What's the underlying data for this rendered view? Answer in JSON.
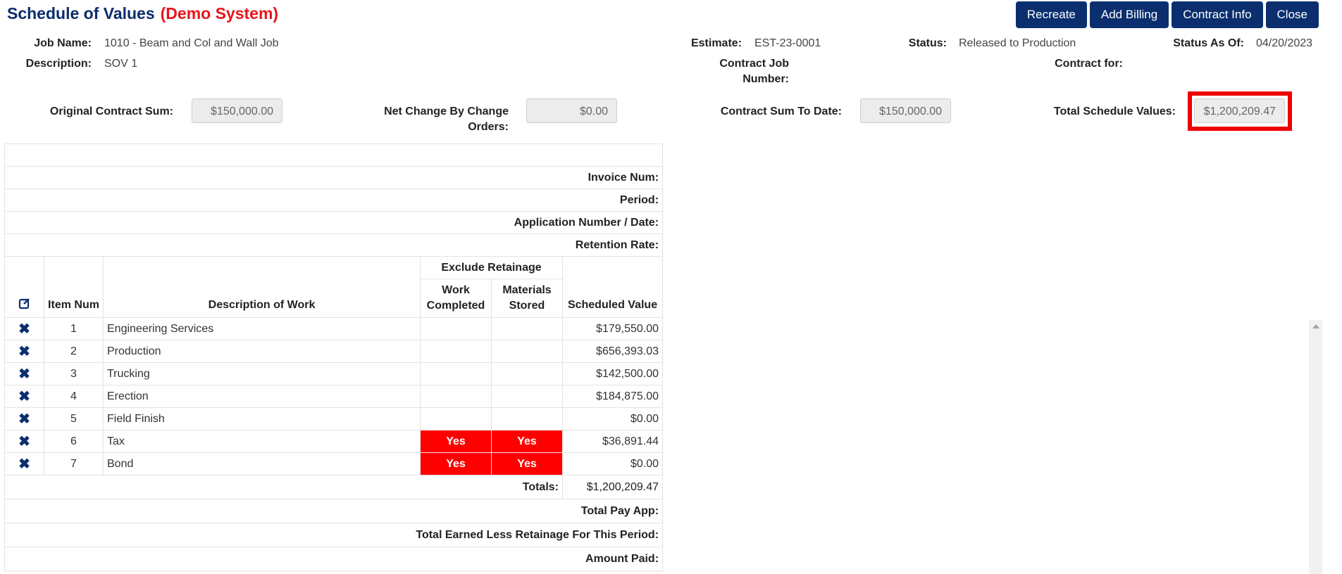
{
  "header": {
    "title": "Schedule of Values",
    "demo_label": "(Demo System)",
    "buttons": {
      "recreate": "Recreate",
      "add_billing": "Add Billing",
      "contract_info": "Contract Info",
      "close": "Close"
    }
  },
  "job": {
    "job_name_label": "Job Name:",
    "job_name": "1010 - Beam and Col and Wall Job",
    "description_label": "Description:",
    "description": "SOV 1",
    "estimate_label": "Estimate:",
    "estimate": "EST-23-0001",
    "contract_job_number_label_1": "Contract Job",
    "contract_job_number_label_2": "Number:",
    "status_label": "Status:",
    "status": "Released to Production",
    "status_as_of_label": "Status As Of:",
    "status_as_of": "04/20/2023",
    "contract_for_label": "Contract for:"
  },
  "sums": {
    "original_contract_label": "Original Contract Sum:",
    "original_contract": "$150,000.00",
    "net_change_label_1": "Net Change By Change",
    "net_change_label_2": "Orders:",
    "net_change": "$0.00",
    "contract_to_date_label": "Contract Sum To Date:",
    "contract_to_date": "$150,000.00",
    "total_schedule_label": "Total Schedule Values:",
    "total_schedule": "$1,200,209.47"
  },
  "meta_rows": {
    "invoice_num": "Invoice Num:",
    "period": "Period:",
    "application": "Application Number / Date:",
    "retention": "Retention Rate:"
  },
  "table": {
    "exclude_retainage": "Exclude Retainage",
    "col_item_num": "Item Num",
    "col_description": "Description of Work",
    "col_work_completed_1": "Work",
    "col_work_completed_2": "Completed",
    "col_materials_stored_1": "Materials",
    "col_materials_stored_2": "Stored",
    "col_scheduled_value": "Scheduled Value",
    "rows": [
      {
        "num": "1",
        "desc": "Engineering Services",
        "work": "",
        "materials": "",
        "value": "$179,550.00"
      },
      {
        "num": "2",
        "desc": "Production",
        "work": "",
        "materials": "",
        "value": "$656,393.03"
      },
      {
        "num": "3",
        "desc": "Trucking",
        "work": "",
        "materials": "",
        "value": "$142,500.00"
      },
      {
        "num": "4",
        "desc": "Erection",
        "work": "",
        "materials": "",
        "value": "$184,875.00"
      },
      {
        "num": "5",
        "desc": "Field Finish",
        "work": "",
        "materials": "",
        "value": "$0.00"
      },
      {
        "num": "6",
        "desc": "Tax",
        "work": "Yes",
        "materials": "Yes",
        "value": "$36,891.44"
      },
      {
        "num": "7",
        "desc": "Bond",
        "work": "Yes",
        "materials": "Yes",
        "value": "$0.00"
      }
    ],
    "totals_label": "Totals:",
    "totals_value": "$1,200,209.47",
    "total_pay_app": "Total Pay App:",
    "total_earned": "Total Earned Less Retainage For This Period:",
    "amount_paid": "Amount Paid:"
  },
  "colors": {
    "brand": "#0b2f6e",
    "demo": "#e8141b",
    "flag": "#ff0000"
  }
}
